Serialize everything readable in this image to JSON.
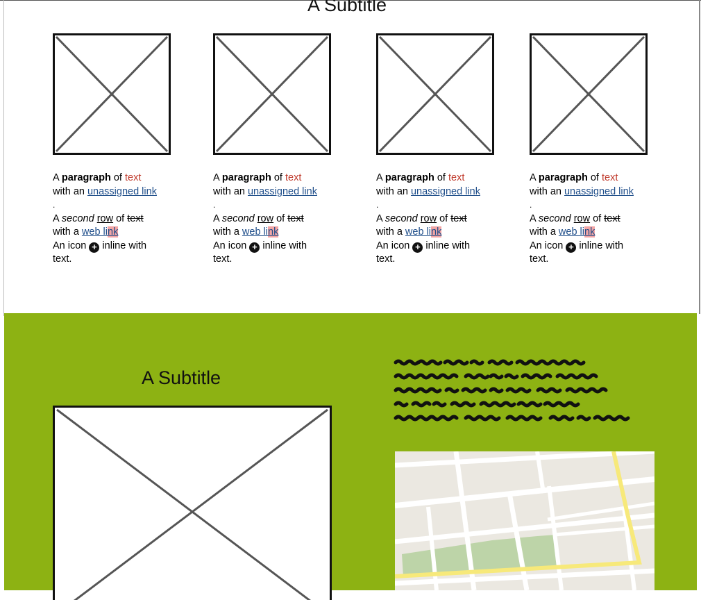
{
  "top_section": {
    "subtitle": "A Subtitle",
    "cards": [
      {
        "line1": {
          "a": "A ",
          "bold": "paragraph",
          "of": " of ",
          "red": "text"
        },
        "line2": {
          "pre": "with an ",
          "link": "unassigned link"
        },
        "dot": ".",
        "line3": {
          "a": "A ",
          "italic": "second",
          "sp": " ",
          "under": "row",
          "of": " of ",
          "strike": "text"
        },
        "line4": {
          "pre": "with a ",
          "link_a": "web li",
          "link_b": "nk"
        },
        "line5": {
          "pre": "An icon ",
          "icon": "+",
          "post": " inline with"
        },
        "line6": "text."
      },
      {
        "line1": {
          "a": "A ",
          "bold": "paragraph",
          "of": " of ",
          "red": "text"
        },
        "line2": {
          "pre": "with an ",
          "link": "unassigned link"
        },
        "dot": ".",
        "line3": {
          "a": "A ",
          "italic": "second",
          "sp": " ",
          "under": "row",
          "of": " of ",
          "strike": "text"
        },
        "line4": {
          "pre": "with a ",
          "link_a": "web li",
          "link_b": "nk"
        },
        "line5": {
          "pre": "An icon ",
          "icon": "+",
          "post": " inline with"
        },
        "line6": "text."
      },
      {
        "line1": {
          "a": "A ",
          "bold": "paragraph",
          "of": " of ",
          "red": "text"
        },
        "line2": {
          "pre": "with an ",
          "link": "unassigned link"
        },
        "dot": ".",
        "line3": {
          "a": "A ",
          "italic": "second",
          "sp": " ",
          "under": "row",
          "of": " of ",
          "strike": "text"
        },
        "line4": {
          "pre": "with a ",
          "link_a": "web li",
          "link_b": "nk"
        },
        "line5": {
          "pre": "An icon ",
          "icon": "+",
          "post": " inline with"
        },
        "line6": "text."
      },
      {
        "line1": {
          "a": "A ",
          "bold": "paragraph",
          "of": " of ",
          "red": "text"
        },
        "line2": {
          "pre": "with an ",
          "link": "unassigned link"
        },
        "dot": ".",
        "line3": {
          "a": "A ",
          "italic": "second",
          "sp": " ",
          "under": "row",
          "of": " of ",
          "strike": "text"
        },
        "line4": {
          "pre": "with a ",
          "link_a": "web li",
          "link_b": "nk"
        },
        "line5": {
          "pre": "An icon ",
          "icon": "+",
          "post": " inline with"
        },
        "line6": "text."
      }
    ]
  },
  "green_section": {
    "subtitle": "A Subtitle",
    "background_color": "#8db213"
  },
  "colors": {
    "text_red": "#c0392b",
    "link_blue": "#1f4e8a",
    "map_road_yellow": "#f7e97a",
    "map_park_green": "#bdd4a8"
  },
  "icons": {
    "placeholder": "image-placeholder-icon",
    "inline": "plus-circle-icon",
    "map": "map-image"
  }
}
